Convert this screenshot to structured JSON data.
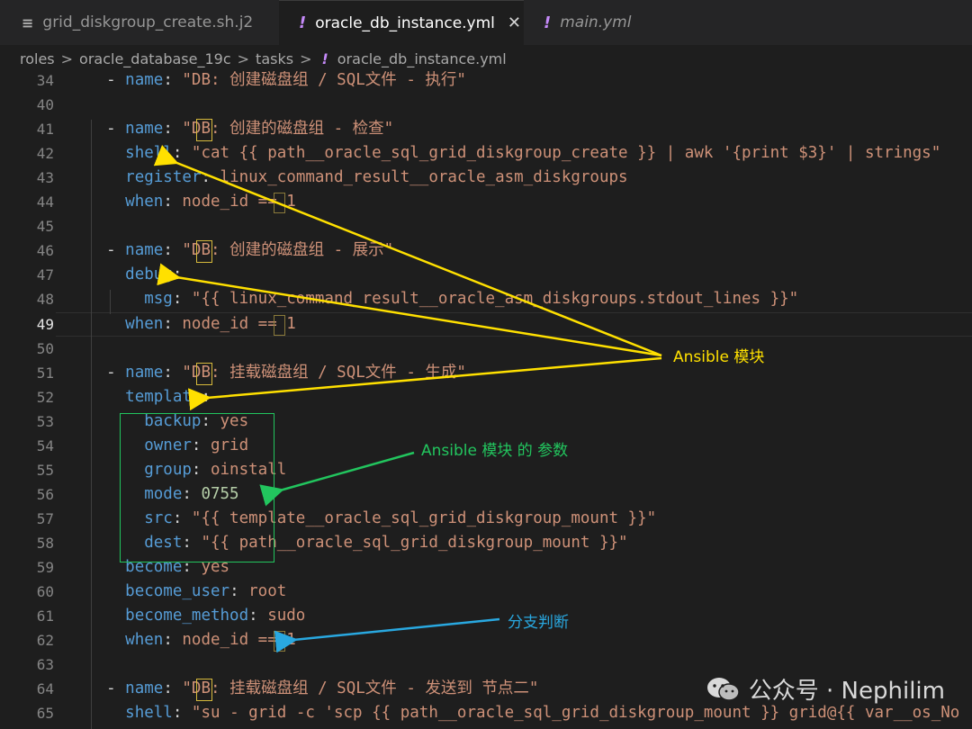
{
  "tabs": [
    {
      "label": "grid_diskgroup_create.sh.j2",
      "icon": "lines-icon"
    },
    {
      "label": "oracle_db_instance.yml",
      "icon": "exclamation-icon",
      "active": true,
      "close": "✕"
    },
    {
      "label": "main.yml",
      "icon": "exclamation-icon"
    }
  ],
  "breadcrumb": {
    "items": [
      "roles",
      "oracle_database_19c",
      "tasks",
      "oracle_db_instance.yml"
    ],
    "separator": ">"
  },
  "code": {
    "lines": [
      {
        "n": "34",
        "t": [
          [
            "p",
            "  - "
          ],
          [
            "k",
            "name"
          ],
          [
            "p",
            ": "
          ],
          [
            "s",
            "\"DB: 创建磁盘组 / SQL文件 - 执行\""
          ]
        ]
      },
      {
        "n": "40",
        "t": []
      },
      {
        "n": "41",
        "t": [
          [
            "p",
            "  - "
          ],
          [
            "k",
            "name"
          ],
          [
            "p",
            ": "
          ],
          [
            "s",
            "\"DB: 创建的磁盘组 - 检查\""
          ]
        ]
      },
      {
        "n": "42",
        "t": [
          [
            "p",
            "    "
          ],
          [
            "k",
            "shell"
          ],
          [
            "p",
            ": "
          ],
          [
            "s",
            "\"cat {{ path__oracle_sql_grid_diskgroup_create }} | awk '{print $3}' | strings\""
          ]
        ]
      },
      {
        "n": "43",
        "t": [
          [
            "p",
            "    "
          ],
          [
            "k",
            "register"
          ],
          [
            "p",
            ": "
          ],
          [
            "s",
            "linux_command_result__oracle_asm_diskgroups"
          ]
        ]
      },
      {
        "n": "44",
        "t": [
          [
            "p",
            "    "
          ],
          [
            "k",
            "when"
          ],
          [
            "p",
            ": "
          ],
          [
            "s",
            "node_id == 1"
          ]
        ]
      },
      {
        "n": "45",
        "t": []
      },
      {
        "n": "46",
        "t": [
          [
            "p",
            "  - "
          ],
          [
            "k",
            "name"
          ],
          [
            "p",
            ": "
          ],
          [
            "s",
            "\"DB: 创建的磁盘组 - 展示\""
          ]
        ]
      },
      {
        "n": "47",
        "t": [
          [
            "p",
            "    "
          ],
          [
            "k",
            "debug"
          ],
          [
            "p",
            ":"
          ]
        ]
      },
      {
        "n": "48",
        "t": [
          [
            "p",
            "      "
          ],
          [
            "k",
            "msg"
          ],
          [
            "p",
            ": "
          ],
          [
            "s",
            "\"{{ linux_command_result__oracle_asm_diskgroups.stdout_lines }}\""
          ]
        ]
      },
      {
        "n": "49",
        "t": [
          [
            "p",
            "    "
          ],
          [
            "k",
            "when"
          ],
          [
            "p",
            ": "
          ],
          [
            "s",
            "node_id == 1"
          ]
        ],
        "current": true
      },
      {
        "n": "50",
        "t": []
      },
      {
        "n": "51",
        "t": [
          [
            "p",
            "  - "
          ],
          [
            "k",
            "name"
          ],
          [
            "p",
            ": "
          ],
          [
            "s",
            "\"DB: 挂载磁盘组 / SQL文件 - 生成\""
          ]
        ]
      },
      {
        "n": "52",
        "t": [
          [
            "p",
            "    "
          ],
          [
            "k",
            "template"
          ],
          [
            "p",
            ":"
          ]
        ]
      },
      {
        "n": "53",
        "t": [
          [
            "p",
            "      "
          ],
          [
            "k",
            "backup"
          ],
          [
            "p",
            ": "
          ],
          [
            "s",
            "yes"
          ]
        ]
      },
      {
        "n": "54",
        "t": [
          [
            "p",
            "      "
          ],
          [
            "k",
            "owner"
          ],
          [
            "p",
            ": "
          ],
          [
            "s",
            "grid"
          ]
        ]
      },
      {
        "n": "55",
        "t": [
          [
            "p",
            "      "
          ],
          [
            "k",
            "group"
          ],
          [
            "p",
            ": "
          ],
          [
            "s",
            "oinstall"
          ]
        ]
      },
      {
        "n": "56",
        "t": [
          [
            "p",
            "      "
          ],
          [
            "k",
            "mode"
          ],
          [
            "p",
            ": "
          ],
          [
            "n",
            "0755"
          ]
        ]
      },
      {
        "n": "57",
        "t": [
          [
            "p",
            "      "
          ],
          [
            "k",
            "src"
          ],
          [
            "p",
            ": "
          ],
          [
            "s",
            "\"{{ template__oracle_sql_grid_diskgroup_mount }}\""
          ]
        ]
      },
      {
        "n": "58",
        "t": [
          [
            "p",
            "      "
          ],
          [
            "k",
            "dest"
          ],
          [
            "p",
            ": "
          ],
          [
            "s",
            "\"{{ path__oracle_sql_grid_diskgroup_mount }}\""
          ]
        ]
      },
      {
        "n": "59",
        "t": [
          [
            "p",
            "    "
          ],
          [
            "k",
            "become"
          ],
          [
            "p",
            ": "
          ],
          [
            "s",
            "yes"
          ]
        ]
      },
      {
        "n": "60",
        "t": [
          [
            "p",
            "    "
          ],
          [
            "k",
            "become_user"
          ],
          [
            "p",
            ": "
          ],
          [
            "s",
            "root"
          ]
        ]
      },
      {
        "n": "61",
        "t": [
          [
            "p",
            "    "
          ],
          [
            "k",
            "become_method"
          ],
          [
            "p",
            ": "
          ],
          [
            "s",
            "sudo"
          ]
        ]
      },
      {
        "n": "62",
        "t": [
          [
            "p",
            "    "
          ],
          [
            "k",
            "when"
          ],
          [
            "p",
            ": "
          ],
          [
            "s",
            "node_id == 1"
          ]
        ]
      },
      {
        "n": "63",
        "t": []
      },
      {
        "n": "64",
        "t": [
          [
            "p",
            "  - "
          ],
          [
            "k",
            "name"
          ],
          [
            "p",
            ": "
          ],
          [
            "s",
            "\"DB: 挂载磁盘组 / SQL文件 - 发送到 节点二\""
          ]
        ]
      },
      {
        "n": "65",
        "t": [
          [
            "p",
            "    "
          ],
          [
            "k",
            "shell"
          ],
          [
            "p",
            ": "
          ],
          [
            "s",
            "\"su - grid -c 'scp {{ path__oracle_sql_grid_diskgroup_mount }} grid@{{ var__os_No"
          ]
        ]
      }
    ]
  },
  "annotations": {
    "ansible_module": {
      "text": "Ansible 模块",
      "color": "#ffe000"
    },
    "ansible_params": {
      "text": "Ansible 模块 的 参数",
      "color": "#22c55e"
    },
    "branch": {
      "text": "分支判断",
      "color": "#29a8e0"
    }
  },
  "watermark": {
    "text": "公众号 · Nephilim",
    "icon": "wechat-icon"
  },
  "colors": {
    "keyword": "#569cd6",
    "string": "#ce9178",
    "number": "#b5cea8",
    "background": "#1e1e1e"
  }
}
